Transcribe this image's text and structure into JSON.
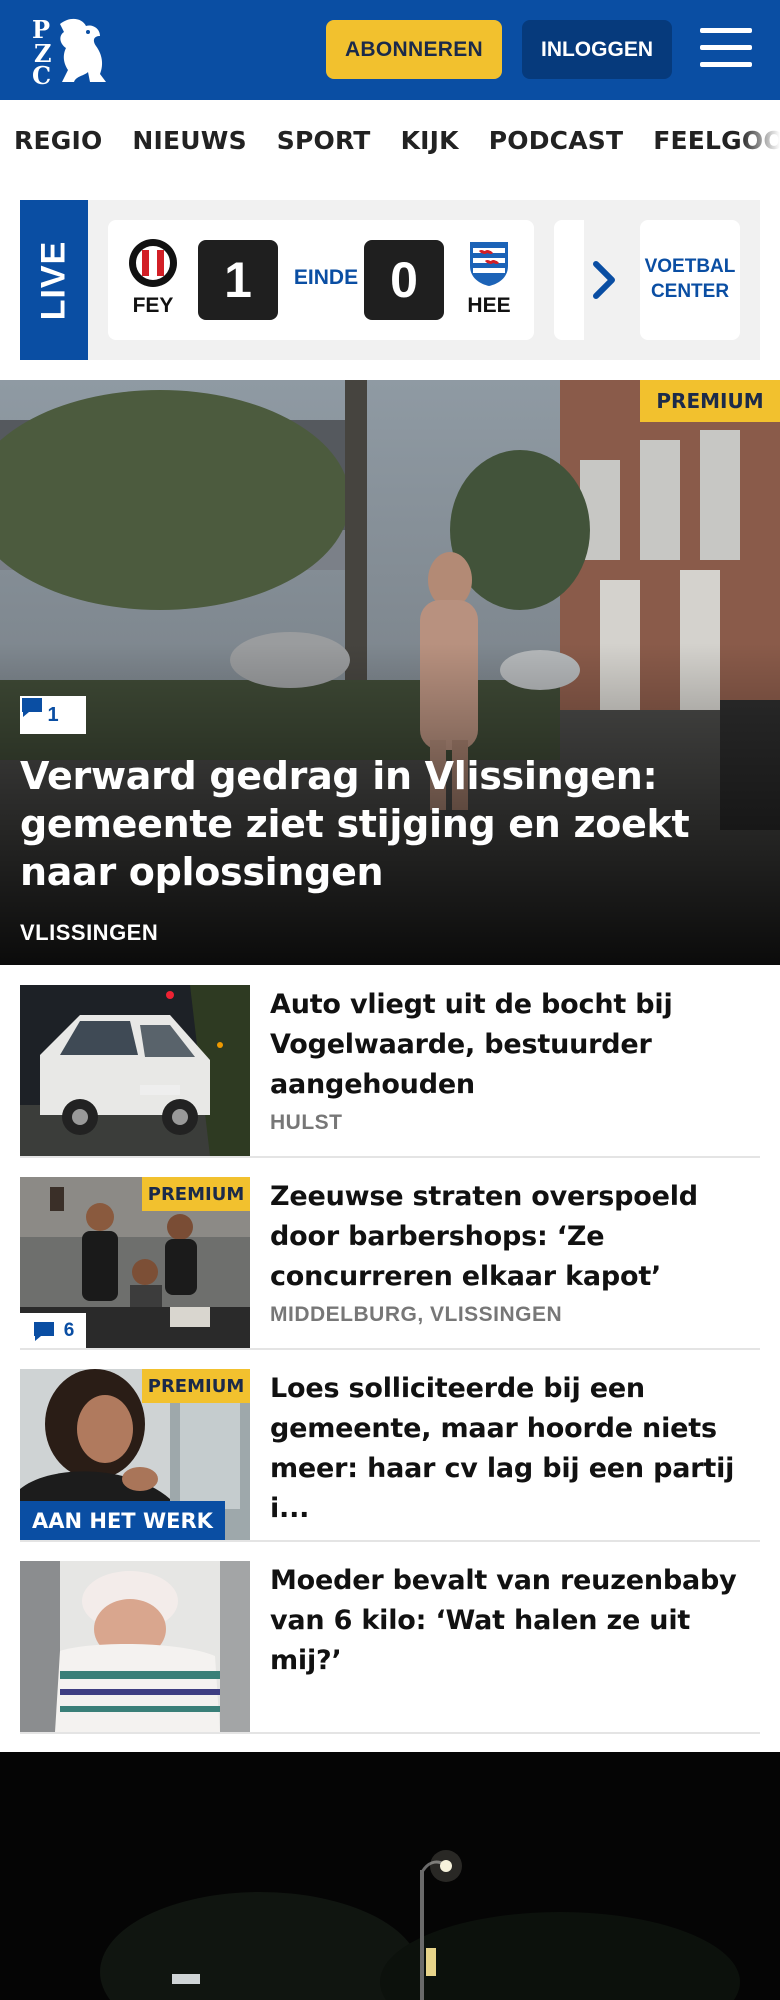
{
  "header": {
    "logo_alt": "PZC",
    "subscribe_label": "ABONNEREN",
    "login_label": "INLOGGEN",
    "colors": {
      "brand_blue": "#0a4ea3",
      "accent_yellow": "#f2c12e"
    }
  },
  "nav": {
    "items": [
      "REGIO",
      "NIEUWS",
      "SPORT",
      "KIJK",
      "PODCAST",
      "FEELGOOD"
    ]
  },
  "live": {
    "label": "LIVE",
    "match": {
      "home_abbr": "FEY",
      "home_score": "1",
      "status": "EINDE",
      "away_score": "0",
      "away_abbr": "HEE"
    },
    "voetbal_center_label": "VOETBAL CENTER"
  },
  "hero": {
    "premium_label": "PREMIUM",
    "comment_count": "1",
    "title": "Verward gedrag in Vlissingen: gemeente ziet stijging en zoekt naar oplossingen",
    "location": "VLISSINGEN"
  },
  "articles": [
    {
      "title": "Auto vliegt uit de bocht bij Vogelwaarde, bestuurder aangehouden",
      "location": "HULST"
    },
    {
      "title": "Zeeuwse straten overspoeld door barbershops: ‘Ze concurreren elkaar kapot’",
      "location": "MIDDELBURG, VLISSINGEN",
      "premium_label": "PREMIUM",
      "comment_count": "6"
    },
    {
      "title": "Loes solliciteerde bij een gemeente, maar hoorde niets meer: haar cv lag bij een partij i...",
      "premium_label": "PREMIUM",
      "series_label": "AAN HET WERK"
    },
    {
      "title": "Moeder bevalt van reuzenbaby van 6 kilo: ‘Wat halen ze uit mij?’"
    }
  ]
}
